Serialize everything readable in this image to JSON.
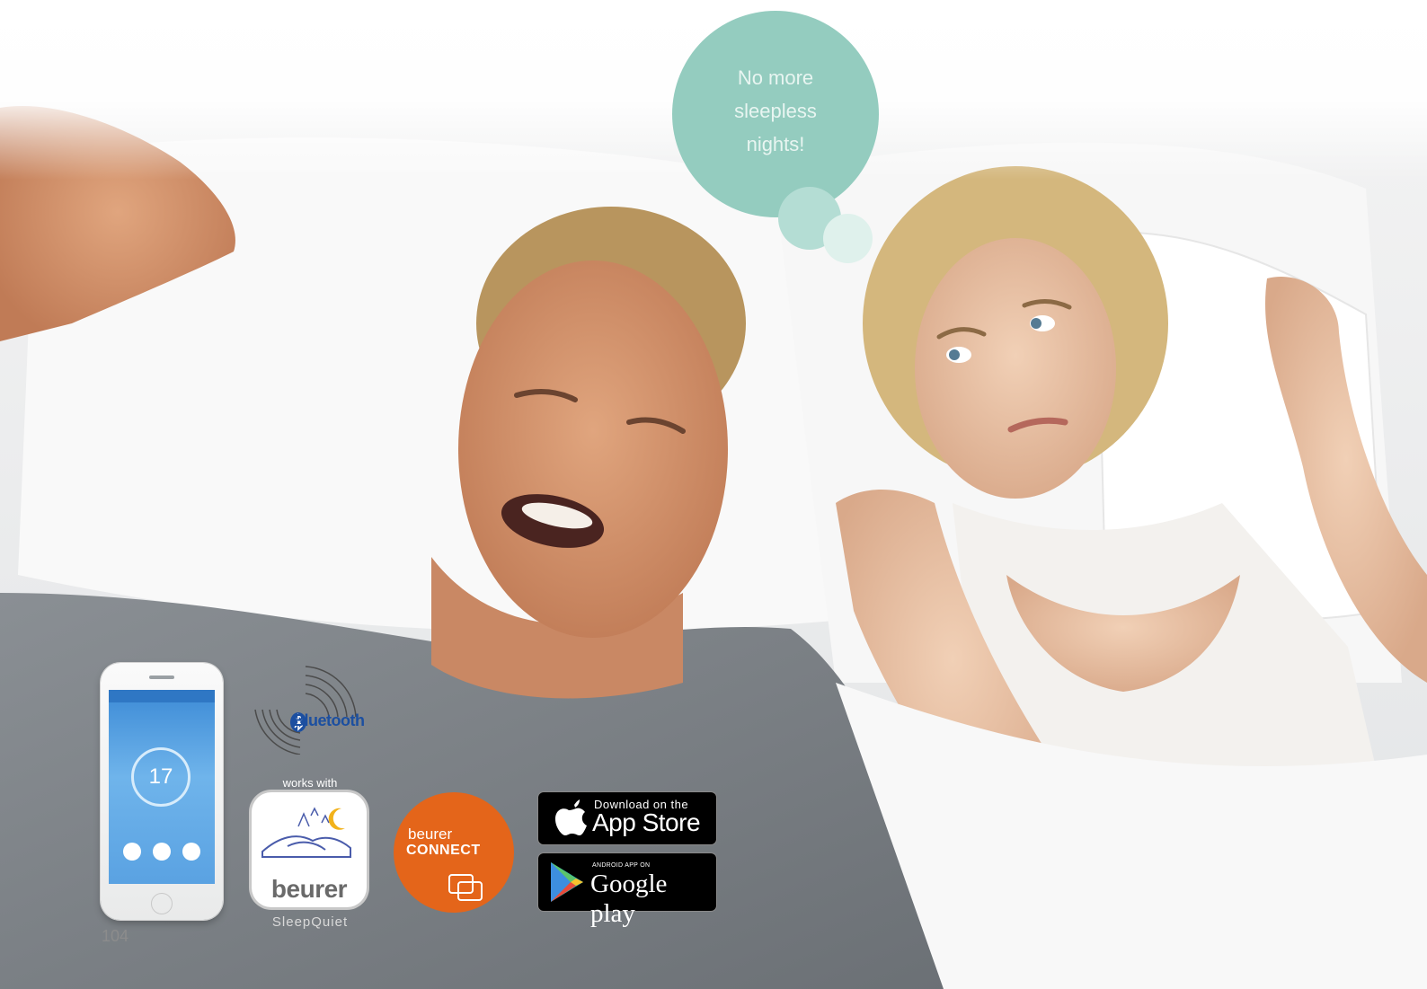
{
  "bubble": {
    "lines": [
      "No more",
      "sleepless",
      "nights!"
    ]
  },
  "phone": {
    "screen_value": "17"
  },
  "bluetooth": {
    "label": "Bluetooth"
  },
  "app": {
    "works_with": "works with",
    "brand": "beurer",
    "name": "SleepQuiet"
  },
  "connect": {
    "top": "beurer",
    "bottom": "CONNECT"
  },
  "app_store": {
    "small": "Download on the",
    "big": "App Store"
  },
  "google_play": {
    "small": "ANDROID APP ON",
    "big": "Google play"
  },
  "page": {
    "number": "104"
  },
  "colors": {
    "bubble": "#94ccbf",
    "connect_orange": "#e4651a",
    "bluetooth_blue": "#1c4fa0"
  }
}
